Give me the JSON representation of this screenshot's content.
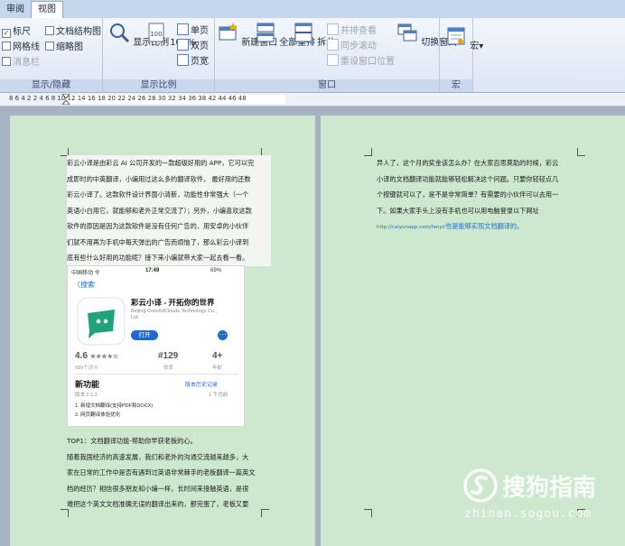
{
  "tabs": [
    "审阅",
    "视图"
  ],
  "ribbon": {
    "show_group": {
      "label": "显示/隐藏",
      "items": [
        {
          "label": "标尺",
          "checked": true
        },
        {
          "label": "文档结构图",
          "checked": false
        },
        {
          "label": "网格线",
          "checked": false
        },
        {
          "label": "缩略图",
          "checked": false
        },
        {
          "label": "消息栏",
          "checked": false
        }
      ]
    },
    "zoom_group": {
      "label": "显示比例",
      "zoom_label": "显示比例",
      "hundred_label": "100%",
      "single": "单页",
      "double": "双页",
      "width": "页宽"
    },
    "window_group": {
      "label": "窗口",
      "new_window": "新建窗口",
      "arrange_all": "全部重排",
      "split": "拆分",
      "side_by_side": "并排查看",
      "sync_scroll": "同步滚动",
      "reset_pos": "重设窗口位置",
      "switch_window": "切换窗口"
    },
    "macro_group": {
      "label": "宏",
      "macro": "宏"
    }
  },
  "ruler": {
    "numbers": "8  6  4  2     2  4  6  8  10 12 14 16 18 20 22 24 26 28 30 32 34 36 38    42 44 46 48"
  },
  "doc": {
    "left_page": {
      "para1": [
        "彩云小译是由彩云 AI 公司开发的一款超级好用的 APP，它可以完",
        "成即时的中英翻译，小编用过这么多的翻译软件， 最好用的还数",
        "彩云小译了。这款软件设计界面小清新，功能性非常强大（一个",
        "英语小白用它，就能够和老外正常交流了）；另外，小编喜欢这款",
        "软件的原因是因为这款软件是没有任何广告的，用安卓的小伙伴",
        "们就不用再为手机中每天弹出的广告而烦恼了，那么彩云小译到",
        "底有些什么好用的功能呢？接下来小编就带大家一起去看一看。"
      ],
      "para2_title": "TOP1：文档翻译功能-帮助你早获老板的心。",
      "para2": [
        "随着我国经济的高速发展，我们和老外的沟通交流越来越多，大",
        "家在日常的工作中是否有遇到过英语非常棘手的老板翻译一篇英文",
        "档的经历？相信很多朋友和小编一样，长时间来接触英语，是很",
        "难把这个英文文档准确无误的翻译出来的，那完蛋了，老板又要"
      ]
    },
    "right_page": {
      "lines": [
        "异人了，这个月的奖金该怎么办？在大家百思莫助的时候，彩云",
        "小译的文档翻译功能就能够轻松解决这个问题。只要你轻轻点几",
        "个按键就可以了，是不是非常简单？有需要的小伙伴可以去用一",
        "下。如果大家手头上没有手机也可以用电脑登录以下网址"
      ],
      "link_url": "http://caiyunapp.com/fanyi/",
      "link_text": "也是能够实现文档翻译的。"
    },
    "phone": {
      "carrier": "中国移动 令",
      "time": "17:49",
      "battery": "69%",
      "back": "搜索",
      "app_name": "彩云小译 - 开拓你的世界",
      "developer": "Beijing ColorfulClouds Technology Co., Ltd.",
      "open": "打开",
      "rating": "4.6",
      "stars": "★★★★☆",
      "rating_count": "689个评分",
      "rank": "#129",
      "rank_label": "效率",
      "age": "4+",
      "age_label": "年龄",
      "new_features": "新功能",
      "history": "版本历史记录",
      "version": "版本 2.1.2",
      "time_ago": "1 个月前",
      "item1": "1. 新增文档翻译(支持PDF和DOCX)",
      "item2": "2. 网页翻译体验优化"
    }
  },
  "watermark": {
    "brand": "搜狗指南",
    "url": "zhinan.sogou.com"
  }
}
